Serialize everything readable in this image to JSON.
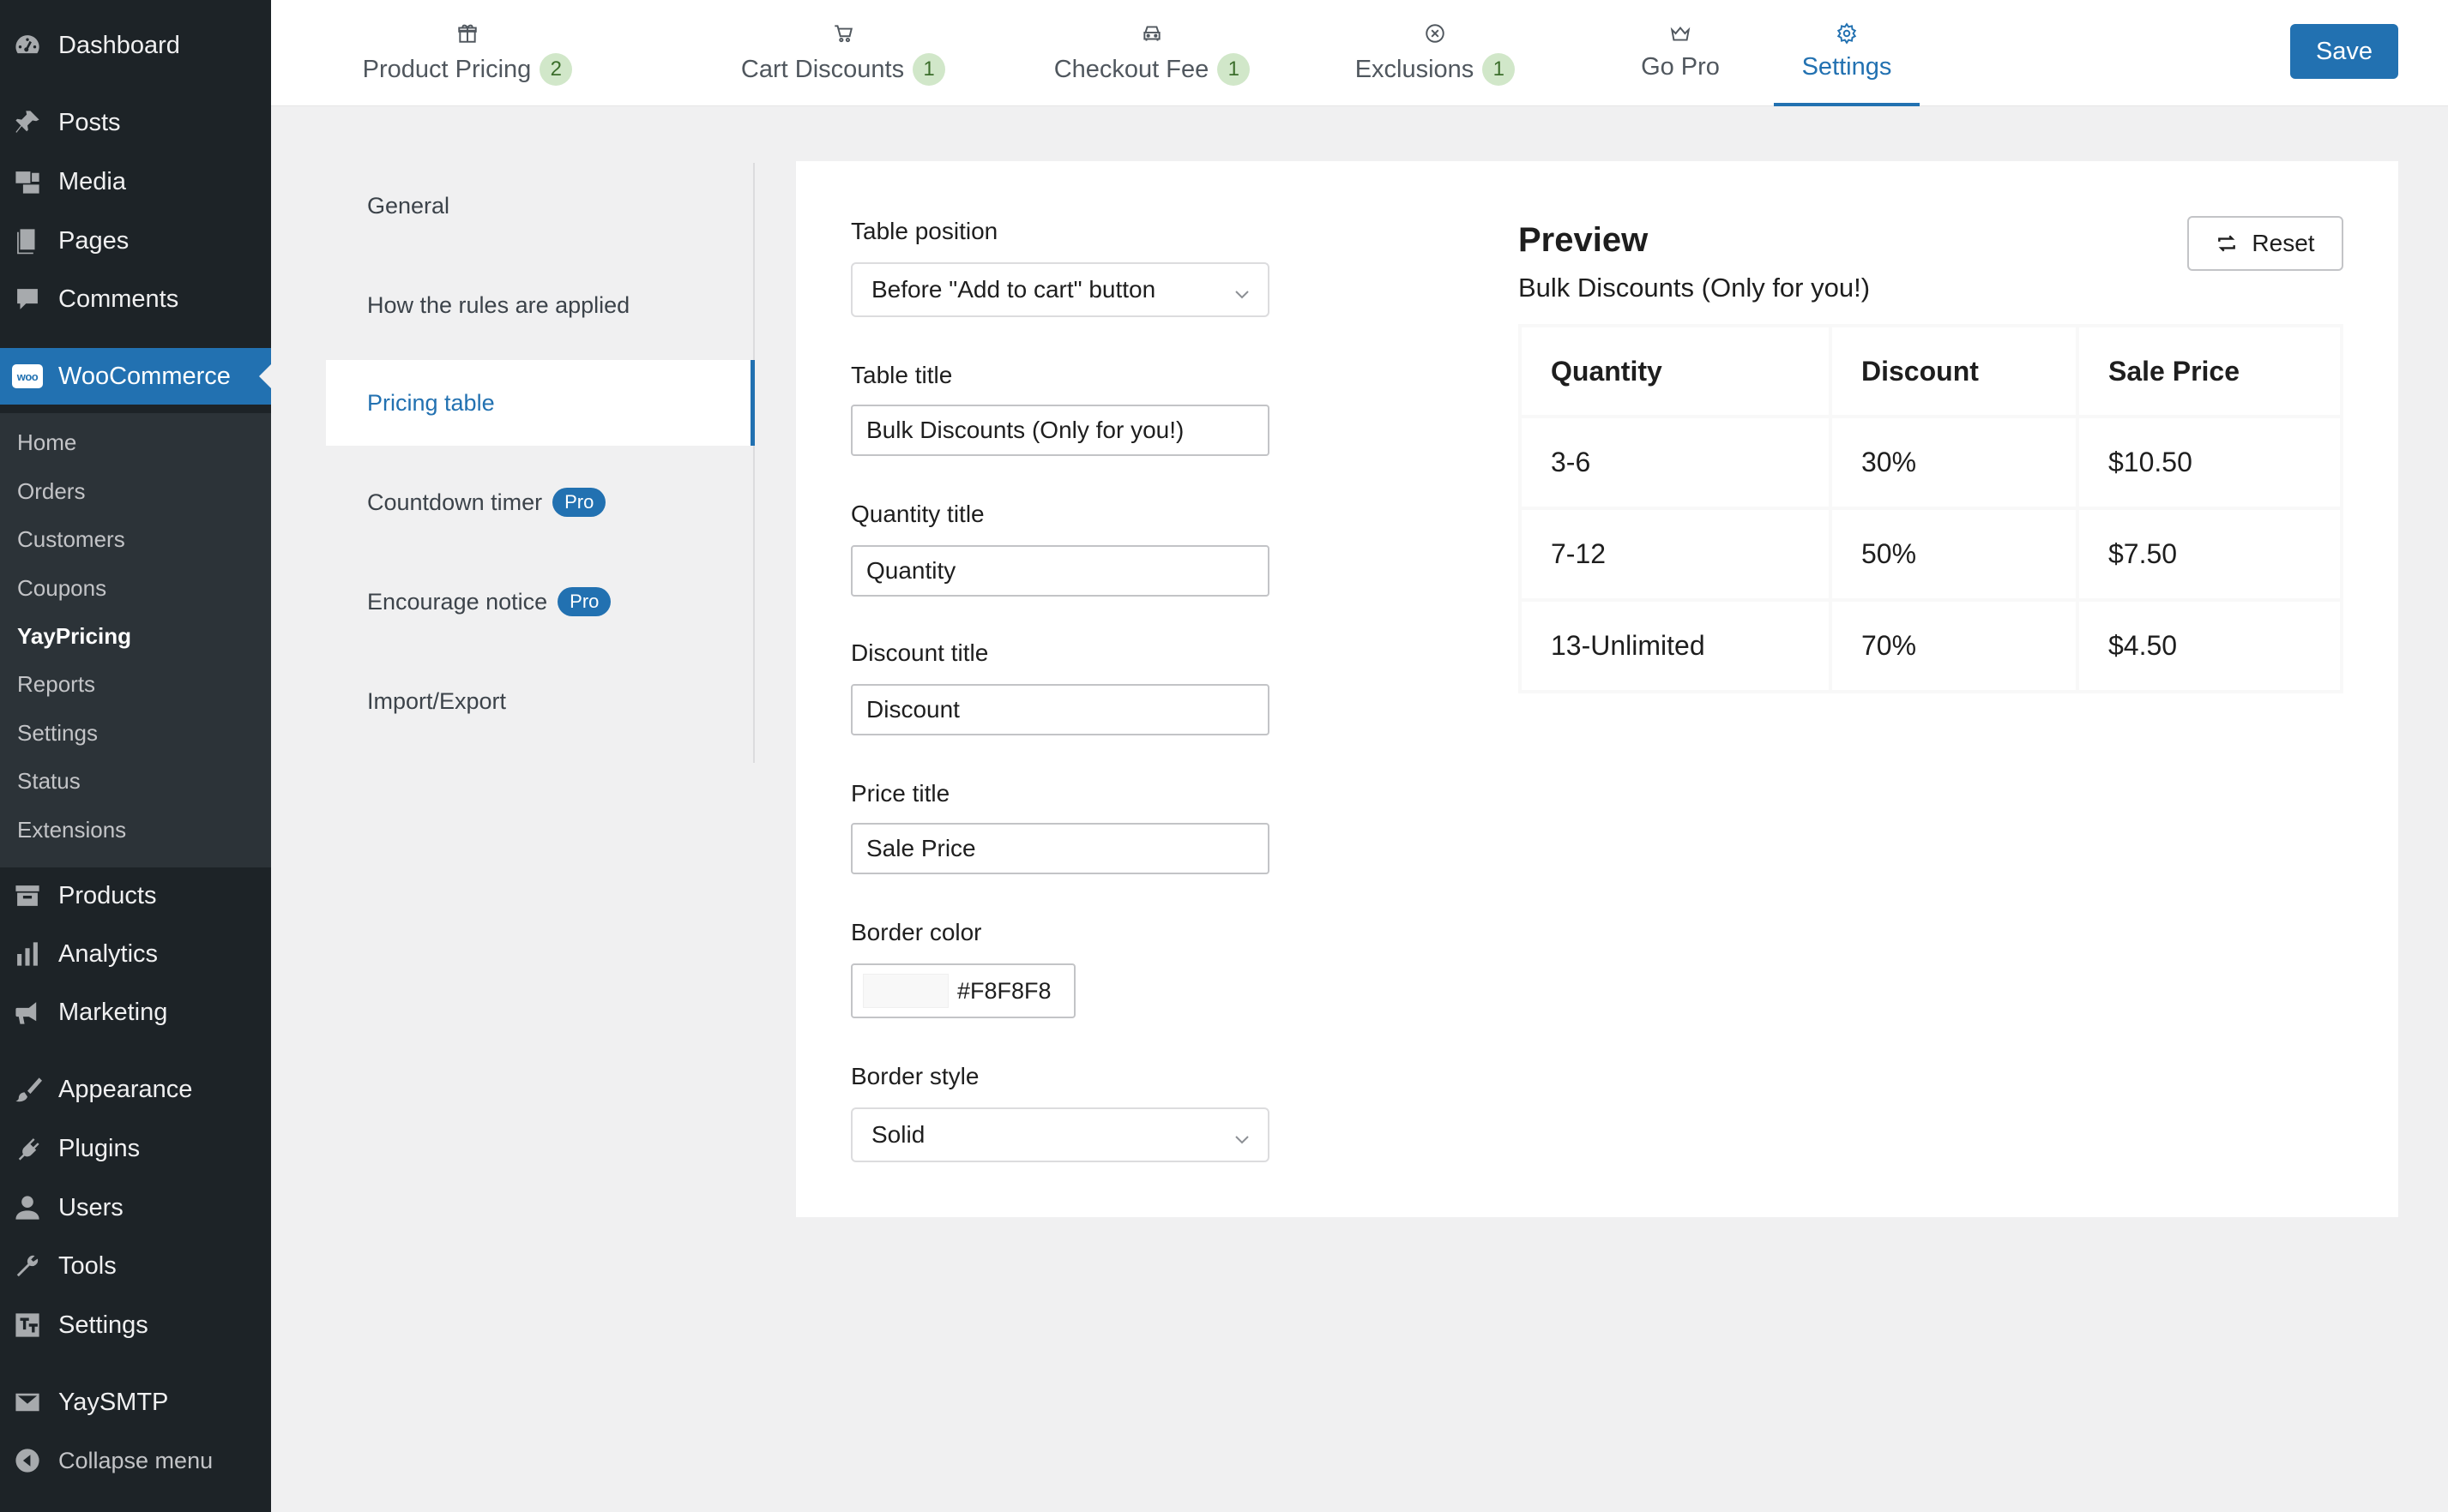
{
  "sidebar": {
    "dashboard": "Dashboard",
    "posts": "Posts",
    "media": "Media",
    "pages": "Pages",
    "comments": "Comments",
    "woocommerce": "WooCommerce",
    "woo_logo_text": "woo",
    "submenu": [
      "Home",
      "Orders",
      "Customers",
      "Coupons",
      "YayPricing",
      "Reports",
      "Settings",
      "Status",
      "Extensions"
    ],
    "current_submenu": "YayPricing",
    "products": "Products",
    "analytics": "Analytics",
    "marketing": "Marketing",
    "appearance": "Appearance",
    "plugins": "Plugins",
    "users": "Users",
    "tools": "Tools",
    "settings": "Settings",
    "yaysmtp": "YaySMTP",
    "collapse": "Collapse menu"
  },
  "tabs": [
    {
      "label": "Product Pricing",
      "count": "2",
      "icon": "gift-icon"
    },
    {
      "label": "Cart Discounts",
      "count": "1",
      "icon": "cart-icon"
    },
    {
      "label": "Checkout Fee",
      "count": "1",
      "icon": "car-icon"
    },
    {
      "label": "Exclusions",
      "count": "1",
      "icon": "x-circle-icon"
    },
    {
      "label": "Go Pro",
      "count": "",
      "icon": "crown-icon"
    },
    {
      "label": "Settings",
      "count": "",
      "icon": "gear-icon"
    }
  ],
  "active_tab": "Settings",
  "save_label": "Save",
  "settings_nav": [
    {
      "label": "General",
      "badge": ""
    },
    {
      "label": "How the rules are applied",
      "badge": ""
    },
    {
      "label": "Pricing table",
      "badge": ""
    },
    {
      "label": "Countdown timer",
      "badge": "Pro"
    },
    {
      "label": "Encourage notice",
      "badge": "Pro"
    },
    {
      "label": "Import/Export",
      "badge": ""
    }
  ],
  "active_settings_nav": "Pricing table",
  "form": {
    "table_position": {
      "label": "Table position",
      "value": "Before \"Add to cart\" button"
    },
    "table_title": {
      "label": "Table title",
      "value": "Bulk Discounts (Only for you!)"
    },
    "quantity_title": {
      "label": "Quantity title",
      "value": "Quantity"
    },
    "discount_title": {
      "label": "Discount title",
      "value": "Discount"
    },
    "price_title": {
      "label": "Price title",
      "value": "Sale Price"
    },
    "border_color": {
      "label": "Border color",
      "value": "#F8F8F8"
    },
    "border_style": {
      "label": "Border style",
      "value": "Solid"
    }
  },
  "preview": {
    "title": "Preview",
    "subtitle": "Bulk Discounts (Only for you!)",
    "reset_label": "Reset",
    "columns": [
      "Quantity",
      "Discount",
      "Sale Price"
    ],
    "rows": [
      [
        "3-6",
        "30%",
        "$10.50"
      ],
      [
        "7-12",
        "50%",
        "$7.50"
      ],
      [
        "13-Unlimited",
        "70%",
        "$4.50"
      ]
    ]
  },
  "colors": {
    "accent": "#2271b1",
    "sidebar_bg": "#1d2327",
    "submenu_bg": "#2c3338",
    "count_badge_bg": "#d1e7c9",
    "table_border": "#F8F8F8"
  }
}
